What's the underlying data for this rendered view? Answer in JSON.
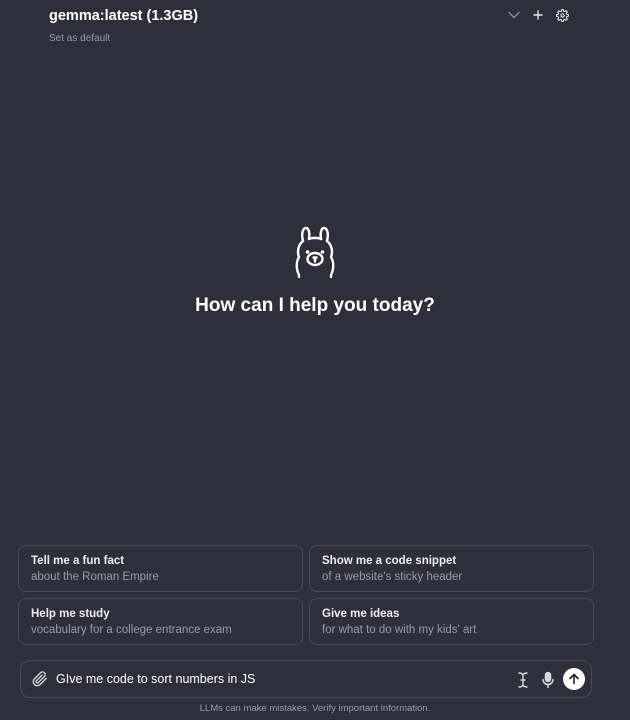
{
  "header": {
    "model_title": "gemma:latest (1.3GB)",
    "set_default_label": "Set as default",
    "icons": [
      "chevron-down-icon",
      "plus-icon",
      "gear-icon"
    ]
  },
  "hero": {
    "logo_icon": "llama-icon",
    "greeting": "How can I help you today?"
  },
  "suggestions": [
    {
      "title": "Tell me a fun fact",
      "subtitle": "about the Roman Empire"
    },
    {
      "title": "Show me a code snippet",
      "subtitle": "of a website's sticky header"
    },
    {
      "title": "Help me study",
      "subtitle": "vocabulary for a college entrance exam"
    },
    {
      "title": "Give me ideas",
      "subtitle": "for what to do with my kids' art"
    }
  ],
  "input": {
    "value": "GIve me code to sort numbers in JS",
    "icons": [
      "paperclip-icon",
      "text-cursor-icon",
      "microphone-icon",
      "arrow-up-icon"
    ]
  },
  "footer": {
    "disclaimer": "LLMs can make mistakes. Verify important information."
  },
  "colors": {
    "background": "#2f2f3b",
    "border": "#4a4a57",
    "muted_text": "#9a9aa6",
    "send_button": "#ffffff"
  }
}
